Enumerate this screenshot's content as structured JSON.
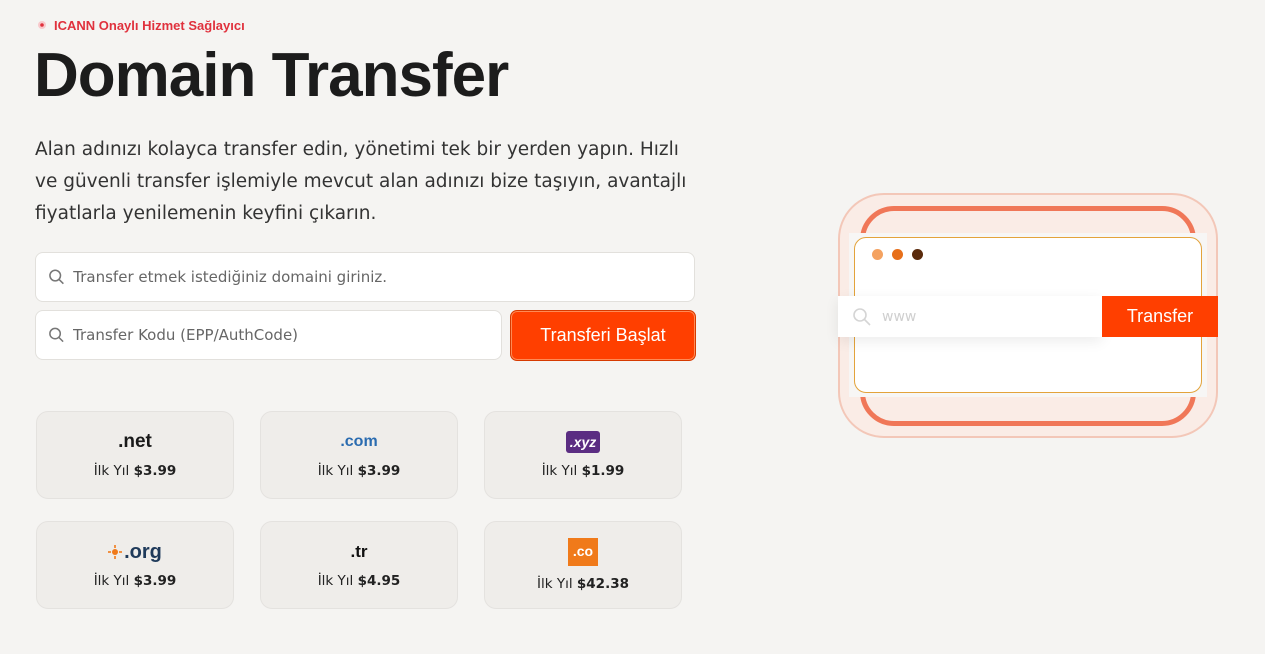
{
  "badge": {
    "text": "ICANN Onaylı Hizmet Sağlayıcı"
  },
  "hero": {
    "title": "Domain Transfer",
    "description": "Alan adınızı kolayca transfer edin, yönetimi tek bir yerden yapın. Hızlı ve güvenli transfer işlemiyle mevcut alan adınızı bize taşıyın, avantajlı fiyatlarla yenilemenin keyfini çıkarın."
  },
  "form": {
    "domain_placeholder": "Transfer etmek istediğiniz domaini giriniz.",
    "code_placeholder": "Transfer Kodu (EPP/AuthCode)",
    "submit_label": "Transferi Başlat"
  },
  "tlds": [
    {
      "ext": ".net",
      "prefix": "İlk Yıl",
      "price": "$3.99"
    },
    {
      "ext": ".com",
      "prefix": "İlk Yıl",
      "price": "$3.99"
    },
    {
      "ext": ".xyz",
      "prefix": "İlk Yıl",
      "price": "$1.99"
    },
    {
      "ext": ".org",
      "prefix": "İlk Yıl",
      "price": "$3.99"
    },
    {
      "ext": ".tr",
      "prefix": "İlk Yıl",
      "price": "$4.95"
    },
    {
      "ext": ".co",
      "prefix": "İlk Yıl",
      "price": "$42.38"
    }
  ],
  "illustration": {
    "search_placeholder": "www",
    "button_label": "Transfer",
    "dot_colors": [
      "#f4a261",
      "#e76f1a",
      "#5a2a0c"
    ]
  },
  "colors": {
    "accent": "#ff3f00",
    "badge": "#e0313d"
  }
}
